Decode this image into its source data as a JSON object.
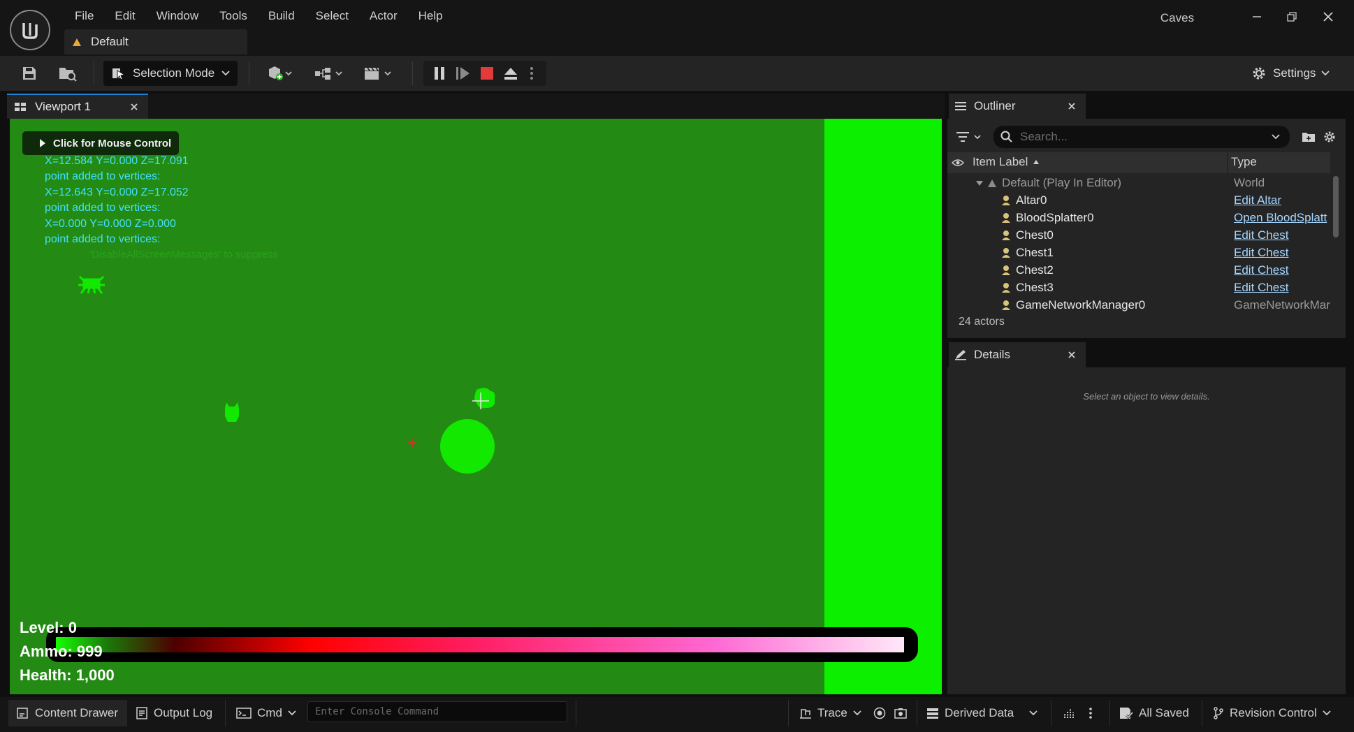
{
  "app": {
    "project_name": "Caves",
    "menu": [
      "File",
      "Edit",
      "Window",
      "Tools",
      "Build",
      "Select",
      "Actor",
      "Help"
    ],
    "document_tab": "Default"
  },
  "toolbar": {
    "selection_mode": "Selection Mode",
    "settings": "Settings"
  },
  "viewport": {
    "tab_label": "Viewport 1",
    "mouse_control": "Click for Mouse Control",
    "debug_messages": [
      "X=12.584 Y=0.000 Z=17.091",
      "point added to vertices:",
      "X=12.643 Y=0.000 Z=17.052",
      "point added to vertices:",
      "X=0.000 Y=0.000 Z=0.000",
      "point added to vertices:"
    ],
    "suppress_hint": "'DisableAllScreenMessages' to suppress",
    "hud": {
      "level": "Level: 0",
      "ammo": "Ammo: 999",
      "health": "Health: 1,000"
    }
  },
  "outliner": {
    "tab_label": "Outliner",
    "search_placeholder": "Search...",
    "col_label": "Item Label",
    "col_type": "Type",
    "root": {
      "label": "Default (Play In Editor)",
      "type": "World"
    },
    "rows": [
      {
        "label": "Altar0",
        "type": "Edit Altar"
      },
      {
        "label": "BloodSplatter0",
        "type": "Open BloodSplatt"
      },
      {
        "label": "Chest0",
        "type": "Edit Chest"
      },
      {
        "label": "Chest1",
        "type": "Edit Chest"
      },
      {
        "label": "Chest2",
        "type": "Edit Chest"
      },
      {
        "label": "Chest3",
        "type": "Edit Chest"
      },
      {
        "label": "GameNetworkManager0",
        "type": "GameNetworkMar"
      }
    ],
    "actor_count": "24 actors"
  },
  "details": {
    "tab_label": "Details",
    "empty_message": "Select an object to view details."
  },
  "statusbar": {
    "content_drawer": "Content Drawer",
    "output_log": "Output Log",
    "cmd": "Cmd",
    "console_placeholder": "Enter Console Command",
    "trace": "Trace",
    "derived_data": "Derived Data",
    "all_saved": "All Saved",
    "revision_control": "Revision Control"
  },
  "colors": {
    "viewport_green": "#238a14",
    "bright_green": "#0cf000",
    "accent_blue": "#1f80d4",
    "link_blue": "#a6d6ff",
    "stop_red": "#e23b3b"
  }
}
